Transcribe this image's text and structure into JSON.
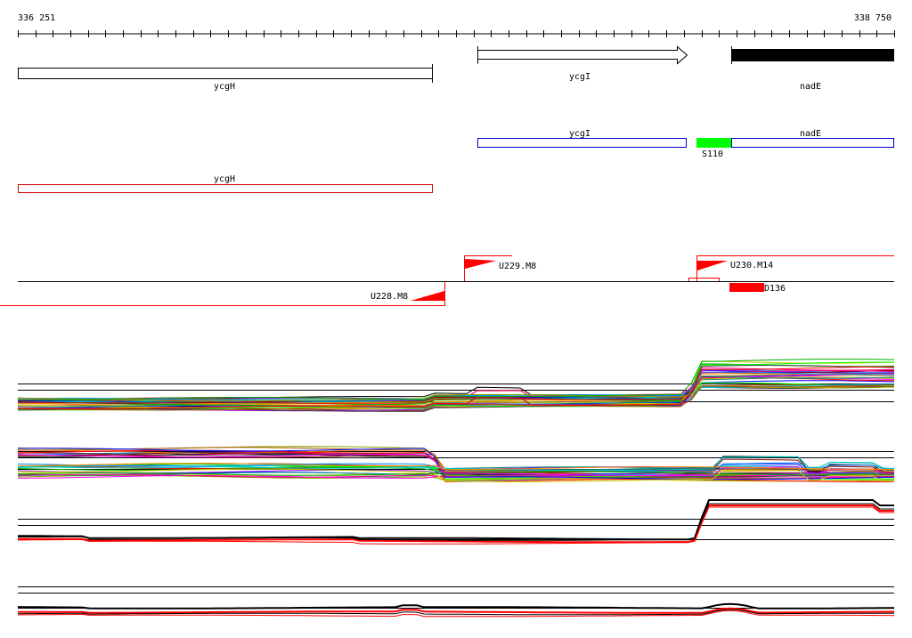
{
  "genome_browser": {
    "range_start_label": "336 251",
    "range_end_label": "338 750"
  },
  "genes": {
    "ycgH": "ycgH",
    "ycgI": "ycgI",
    "nadE": "nadE"
  },
  "transcripts": {
    "ycgI": "ycgI",
    "nadE": "nadE",
    "ycgH": "ycgH",
    "S110": "S110"
  },
  "promoters": {
    "U229": "U229.M8",
    "U230": "U230.M14",
    "U228": "U228.M8",
    "D136": "D136"
  },
  "colors": {
    "gene_outline": "#000000",
    "nadE_fill": "#000000",
    "forward_transcript": "#0000cc",
    "reverse_transcript": "#cc0000",
    "small_rna": "#00ff00",
    "promoter_flag": "#ff0000",
    "terminator": "#ff0000"
  },
  "expression_panels": [
    {
      "name": "panel-1",
      "traces": "many-colored"
    },
    {
      "name": "panel-2",
      "traces": "many-colored"
    },
    {
      "name": "panel-3",
      "traces": "black-red"
    },
    {
      "name": "panel-4",
      "traces": "black-red"
    }
  ]
}
